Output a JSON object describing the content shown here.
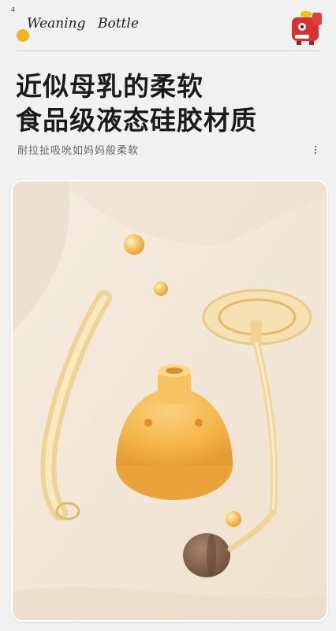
{
  "brand": {
    "top_mark": "4",
    "logo_left": "Weaning",
    "logo_right": "Bottle"
  },
  "headline": {
    "line1": "近似母乳的柔软",
    "line2": "食品级液态硅胶材质"
  },
  "subtitle": "耐拉扯吸吮如妈妈般柔软",
  "colors": {
    "background": "#f1f1f1",
    "card_background": "#f3e7d8",
    "silicone_amber": "#f5b54a",
    "tube_amber": "#eecf8a",
    "weight_brown": "#8a6550",
    "mascot_red": "#d8322e"
  },
  "icons": {
    "more": "more-vertical-icon",
    "mascot": "dinosaur-mascot-icon",
    "logo_dot": "sun-dot-icon"
  }
}
